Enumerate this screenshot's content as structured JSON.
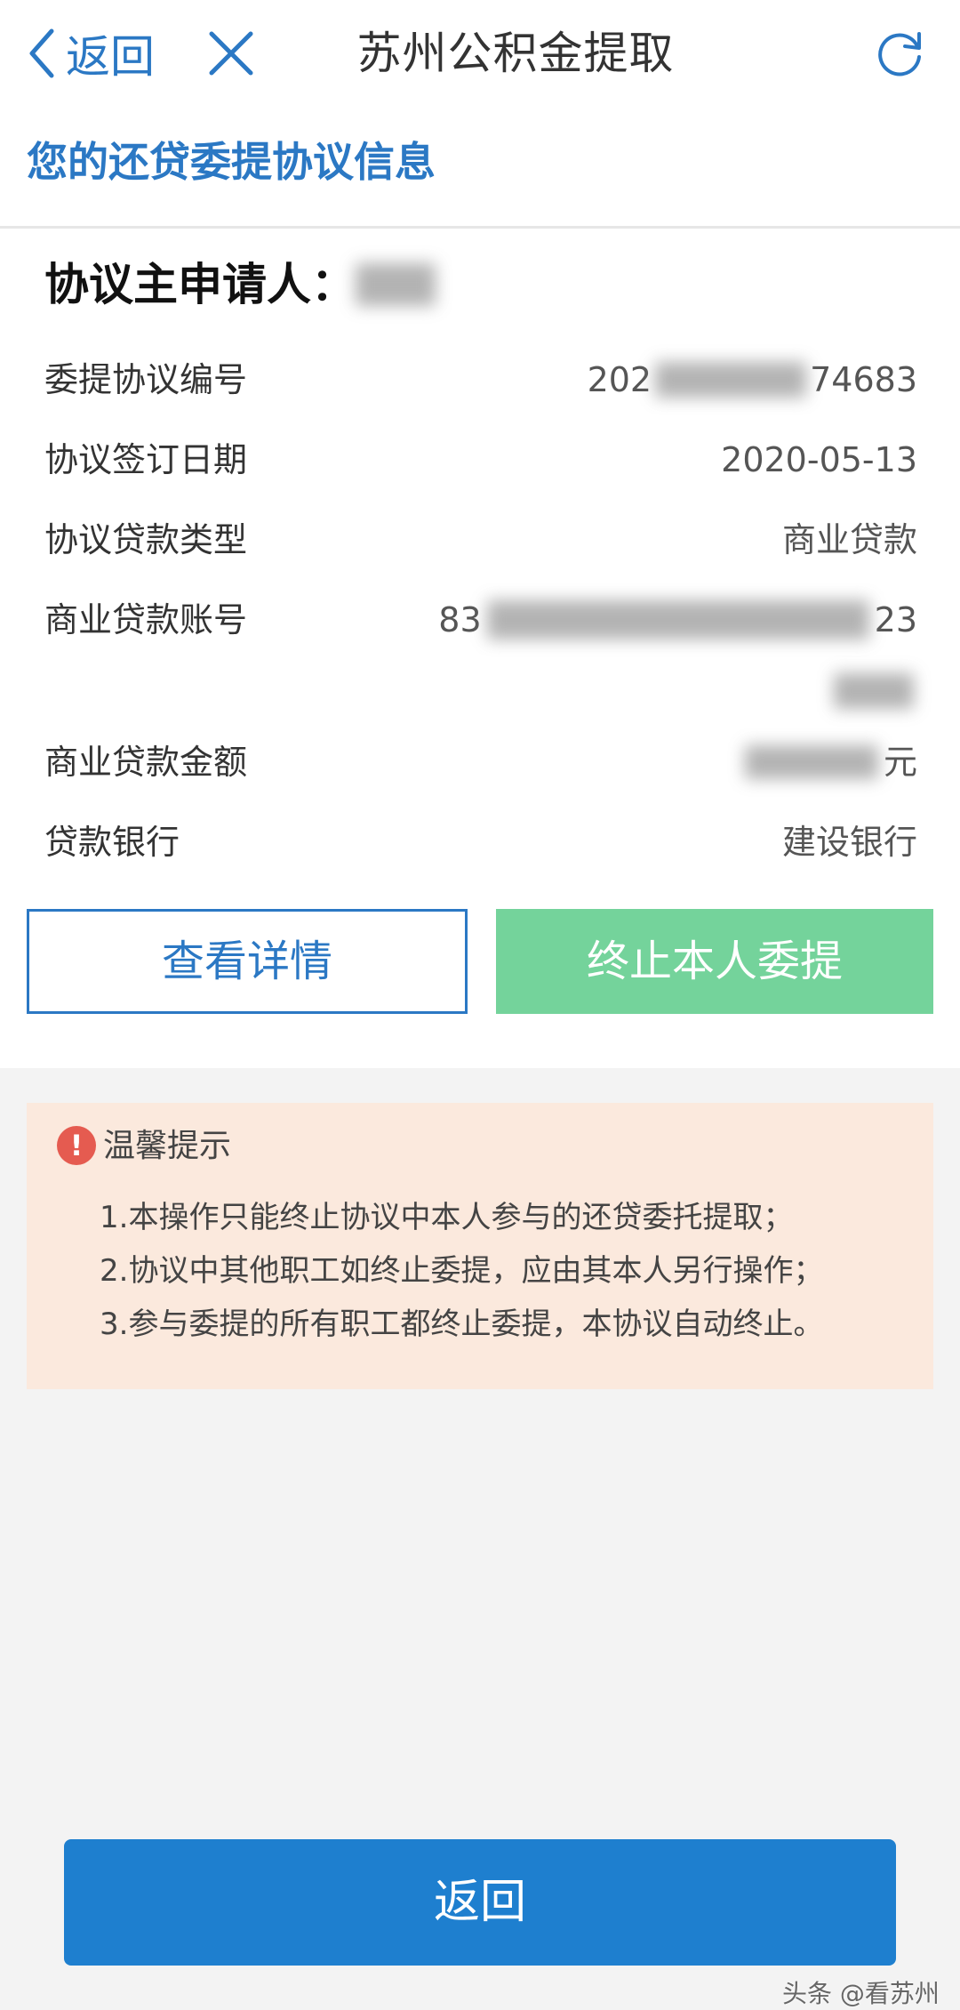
{
  "nav": {
    "back_label": "返回",
    "title": "苏州公积金提取",
    "accent_color": "#2b78c4"
  },
  "section": {
    "title": "您的还贷委提协议信息"
  },
  "agreement": {
    "applicant_label": "协议主申请人：",
    "rows": [
      {
        "label": "委提协议编号",
        "value_start": "202",
        "value_end": "74683"
      },
      {
        "label": "协议签订日期",
        "value": "2020-05-13"
      },
      {
        "label": "协议贷款类型",
        "value": "商业贷款"
      },
      {
        "label": "商业贷款账号",
        "value_start": "83",
        "value_end": "23"
      },
      {
        "label": "商业贷款金额",
        "value_end": "元"
      },
      {
        "label": "贷款银行",
        "value": "建设银行"
      }
    ]
  },
  "actions": {
    "detail_label": "查看详情",
    "stop_label": "终止本人委提",
    "stop_color": "#74d39b"
  },
  "notice": {
    "title": "温馨提示",
    "icon": "exclamation-icon",
    "lines": [
      "1.本操作只能终止协议中本人参与的还贷委托提取；",
      "2.协议中其他职工如终止委提，应由其本人另行操作；",
      "3.参与委提的所有职工都终止委提，本协议自动终止。"
    ]
  },
  "footer": {
    "return_label": "返回",
    "return_color": "#1e7fcf",
    "watermark": "头条 @看苏州"
  }
}
